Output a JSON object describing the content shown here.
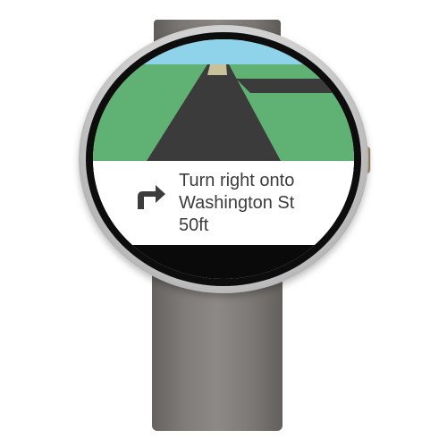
{
  "navigation": {
    "icon": "turn-right-arrow-icon",
    "instruction_line1": "Turn right onto",
    "instruction_line2": "Washington St",
    "distance": "50ft"
  },
  "colors": {
    "sky": "#8fd3ea",
    "grass": "#5fb273",
    "road": "#3b3b3b",
    "road_horizon": "#c8c29a",
    "card_bg": "#ffffff",
    "text": "#3c3c3c",
    "icon": "#3c3c3c"
  }
}
